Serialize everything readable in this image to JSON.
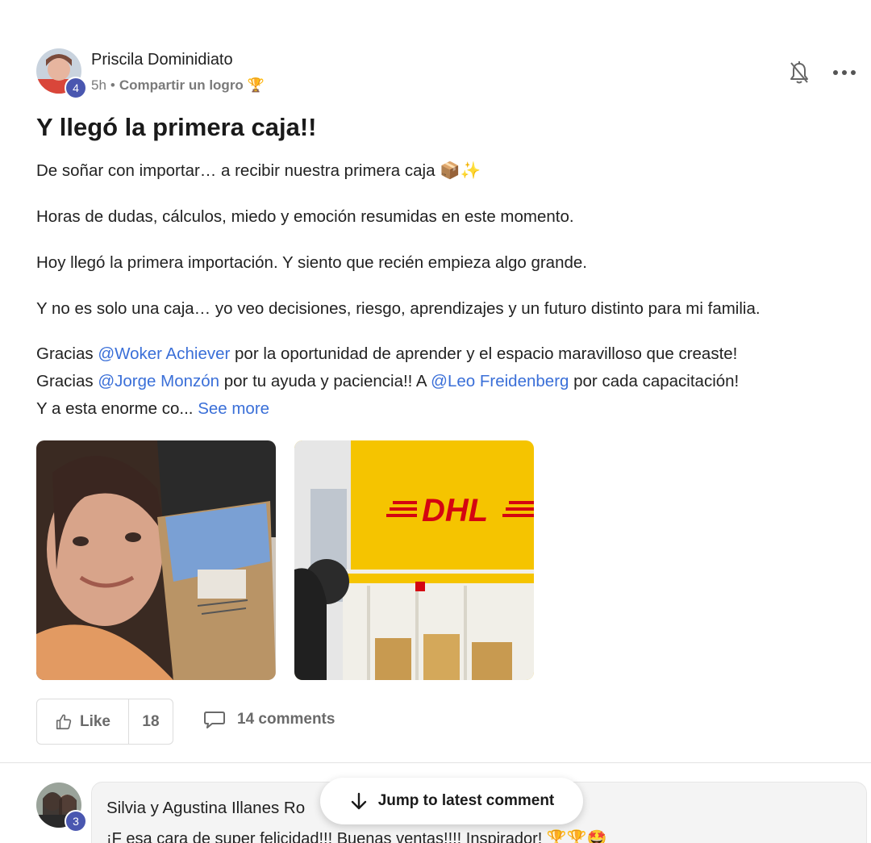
{
  "post": {
    "author": "Priscila Dominidiato",
    "level": "4",
    "time": "5h",
    "separator": "•",
    "category": "Compartir un logro",
    "category_emoji": "🏆",
    "title": "Y llegó la primera caja!!",
    "paragraphs": [
      "De soñar con importar… a recibir nuestra primera caja 📦✨",
      "Horas de dudas, cálculos, miedo y emoción resumidas en este momento.",
      "Hoy llegó la primera importación. Y siento que recién empieza algo grande.",
      "Y no es solo una caja… yo veo decisiones, riesgo, aprendizajes y un futuro distinto para mi familia."
    ],
    "thanks_line1": {
      "pre": "Gracias ",
      "mention": "@Woker Achiever",
      "post": " por la oportunidad de aprender y el espacio maravilloso que creaste!"
    },
    "thanks_line2": {
      "pre": "Gracias ",
      "mention1": "@Jorge Monzón",
      "mid": " por tu ayuda y paciencia!! A ",
      "mention2": "@Leo Freidenberg",
      "post": " por cada capacitación!"
    },
    "thanks_line3": {
      "pre": "Y a esta enorme co...",
      "see_more": "See more"
    },
    "photos": [
      {
        "name": "selfie-with-box-photo",
        "depicts": "woman smiling holding a cardboard box"
      },
      {
        "name": "dhl-office-photo",
        "depicts": "DHL service counter with yellow wall"
      }
    ],
    "dhl_logo_text": "DHL",
    "actions": {
      "like_label": "Like",
      "like_count": "18",
      "comments_label": "14 comments"
    }
  },
  "comment": {
    "author": "Silvia y Agustina Illanes Ro",
    "level": "3",
    "text": "¡F esa cara de super felicidad!!! Buenas ventas!!!! Inspirador! 🏆🏆🤩"
  },
  "jump_button": {
    "label": "Jump to latest comment"
  },
  "icons": {
    "bell": "bell-off-icon",
    "more": "more-horizontal-icon",
    "like": "thumbs-up-icon",
    "comment": "comment-bubble-icon",
    "arrow": "arrow-down-icon"
  },
  "colors": {
    "mention": "#3a6fd8",
    "badge": "#4a57b0",
    "dhl_yellow": "#f5c400",
    "dhl_red": "#d40511"
  }
}
